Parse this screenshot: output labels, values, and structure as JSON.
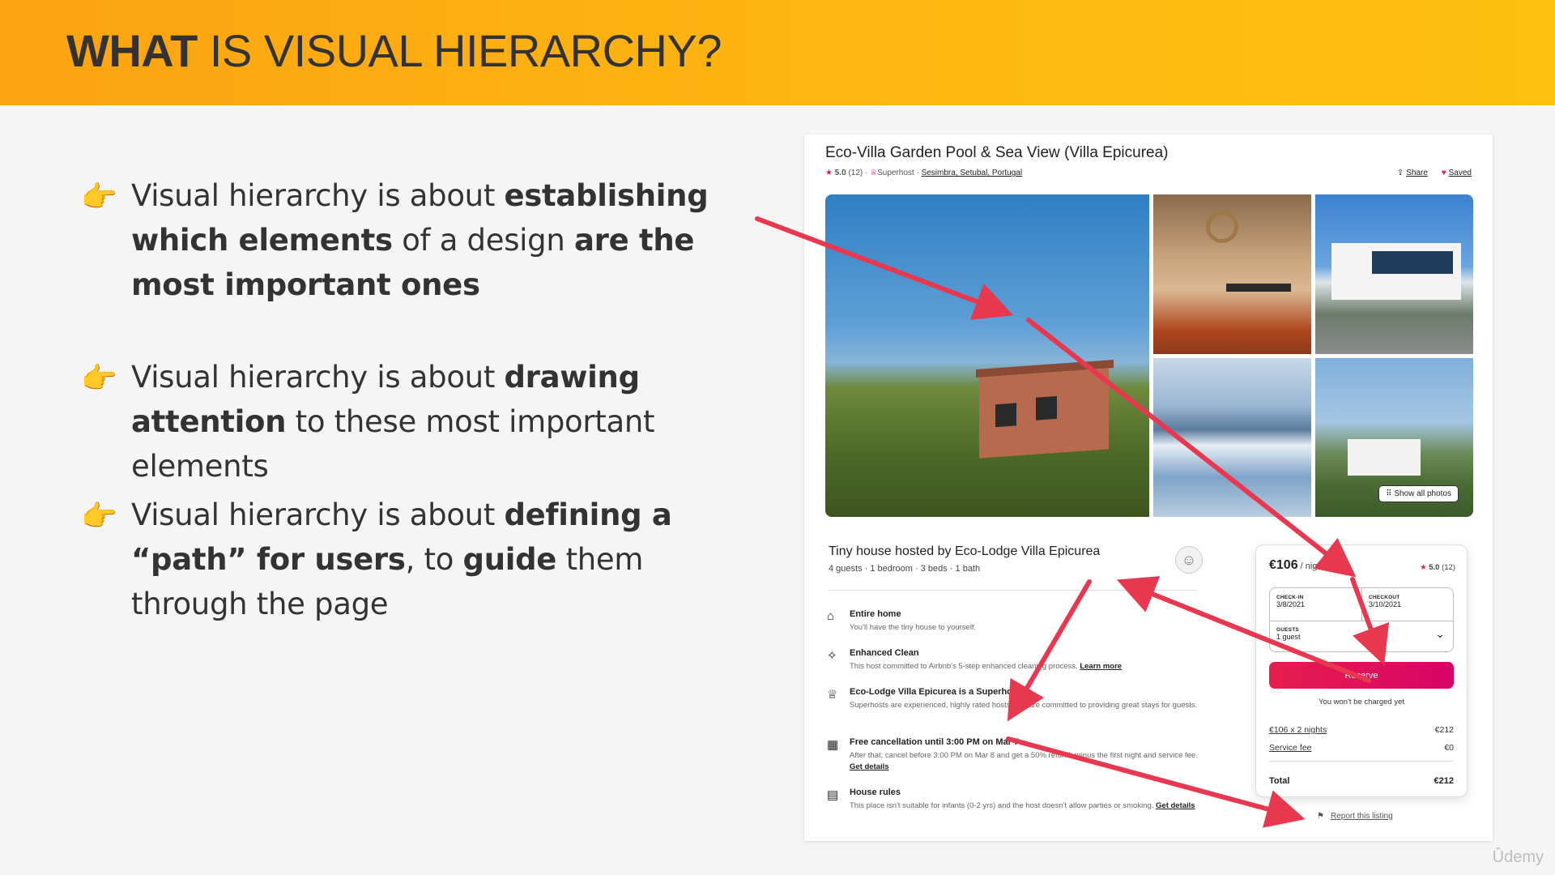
{
  "slide": {
    "title_bold": "WHAT",
    "title_rest": " IS VISUAL HIERARCHY?"
  },
  "bullets": [
    {
      "icon": "👉",
      "parts": [
        "Visual hierarchy is about ",
        "establishing which elements",
        " of a design ",
        "are the most important ones",
        ""
      ]
    },
    {
      "icon": "👉",
      "parts": [
        "Visual hierarchy is about ",
        "drawing attention",
        " to these most important elements",
        "",
        ""
      ]
    },
    {
      "icon": "👉",
      "parts": [
        "Visual hierarchy is about ",
        "defining a “path” for users",
        ", to ",
        "guide",
        " them through the page"
      ]
    }
  ],
  "listing": {
    "title": "Eco-Villa Garden Pool & Sea View (Villa Epicurea)",
    "rating": "5.0",
    "reviews": "(12)",
    "superhost": "Superhost",
    "location": "Sesimbra, Setubal, Portugal",
    "share_label": "Share",
    "saved_label": "Saved",
    "show_all_photos": "Show all photos",
    "host_title": "Tiny house hosted by Eco-Lodge Villa Epicurea",
    "host_sub": "4 guests · 1 bedroom · 3 beds · 1 bath",
    "features": [
      {
        "icon": "⌂",
        "title": "Entire home",
        "desc": "You'll have the tiny house to yourself.",
        "link": ""
      },
      {
        "icon": "✧",
        "title": "Enhanced Clean",
        "desc": "This host committed to Airbnb's 5-step enhanced cleaning process. ",
        "link": "Learn more"
      },
      {
        "icon": "♕",
        "title": "Eco-Lodge Villa Epicurea is a Superhost",
        "desc": "Superhosts are experienced, highly rated hosts who are committed to providing great stays for guests.",
        "link": ""
      },
      {
        "icon": "▦",
        "title": "Free cancellation until 3:00 PM on Mar 7",
        "desc": "After that, cancel before 3:00 PM on Mar 8 and get a 50% refund, minus the first night and service fee. ",
        "link": "Get details"
      },
      {
        "icon": "▤",
        "title": "House rules",
        "desc": "This place isn't suitable for infants (0-2 yrs) and the host doesn't allow parties or smoking. ",
        "link": "Get details"
      }
    ],
    "report": "Report this listing"
  },
  "booking": {
    "price": "€106",
    "per_night": " / night",
    "rating": "5.0",
    "reviews": "(12)",
    "checkin_label": "CHECK-IN",
    "checkin_value": "3/8/2021",
    "checkout_label": "CHECKOUT",
    "checkout_value": "3/10/2021",
    "guests_label": "GUESTS",
    "guests_value": "1 guest",
    "reserve_label": "Reserve",
    "note": "You won't be charged yet",
    "line1_label": "€106 x 2 nights",
    "line1_value": "€212",
    "line2_label": "Service fee",
    "line2_value": "€0",
    "total_label": "Total",
    "total_value": "€212"
  },
  "colors": {
    "header_start": "#fca311",
    "header_end": "#fec10f",
    "arrow": "#e8384f",
    "brand": "#e31c5f"
  },
  "watermark": "Ûdemy"
}
